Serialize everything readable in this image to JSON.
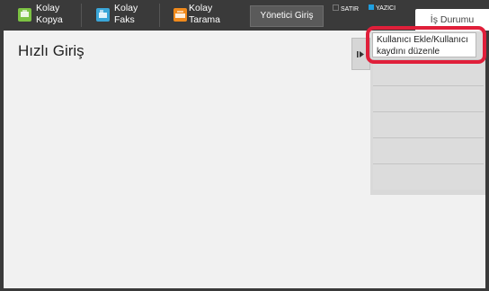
{
  "topbar": {
    "apps": [
      {
        "line1": "Kolay",
        "line2": "Kopya",
        "icon": "easy-copy-icon",
        "color": "#7cc243"
      },
      {
        "line1": "Kolay",
        "line2": "Faks",
        "icon": "easy-fax-icon",
        "color": "#3aa6d8"
      },
      {
        "line1": "Kolay",
        "line2": "Tarama",
        "icon": "easy-scan-icon",
        "color": "#f08a1c"
      }
    ],
    "admin_login": "Yönetici Giriş",
    "indicators": [
      {
        "label": "SATIR",
        "color": "#3a3a3a"
      },
      {
        "label": "YAZICI",
        "color": "#1f9fe0"
      }
    ],
    "job_status": "İş Durumu"
  },
  "main": {
    "title": "Hızlı Giriş"
  },
  "action_panel": {
    "items": [
      "Kullanıcı Ekle/Kullanıcı kaydını düzenle"
    ],
    "highlight_color": "#e01f3a"
  }
}
